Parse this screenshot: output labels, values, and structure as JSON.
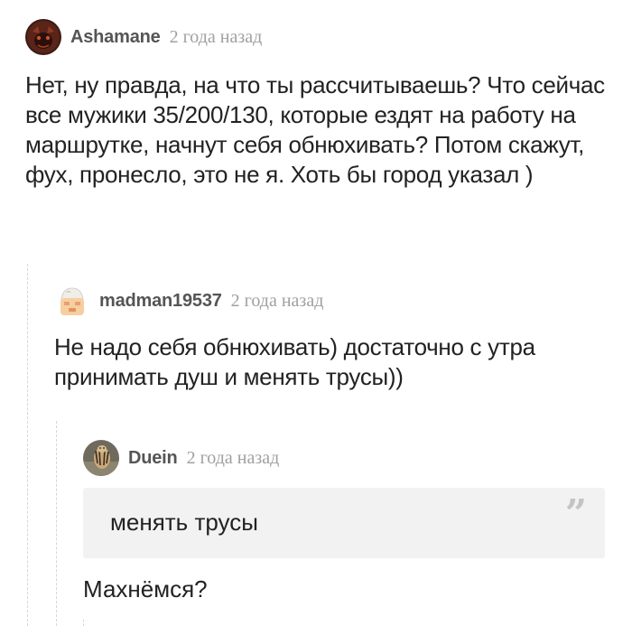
{
  "comments": [
    {
      "author": "Ashamane",
      "time": "2 года назад",
      "avatar_icon": "dark-creature-avatar",
      "text": "Нет, ну правда, на что ты рассчитываешь? Что сейчас все мужики 35/200/130, которые ездят на работу на маршрутке, начнут себя обнюхивать? Потом скажут, фух, пронесло, это не я. Хоть бы город указал )"
    },
    {
      "author": "madman19537",
      "time": "2 года назад",
      "avatar_icon": "cartoon-face-avatar",
      "text": "Не надо себя обнюхивать) достаточно с утра принимать душ и менять трусы))"
    },
    {
      "author": "Duein",
      "time": "2 года назад",
      "avatar_icon": "tiger-avatar",
      "quote": "менять трусы",
      "quote_icon": "quote-marks-icon",
      "text": "Махнёмся?"
    }
  ]
}
